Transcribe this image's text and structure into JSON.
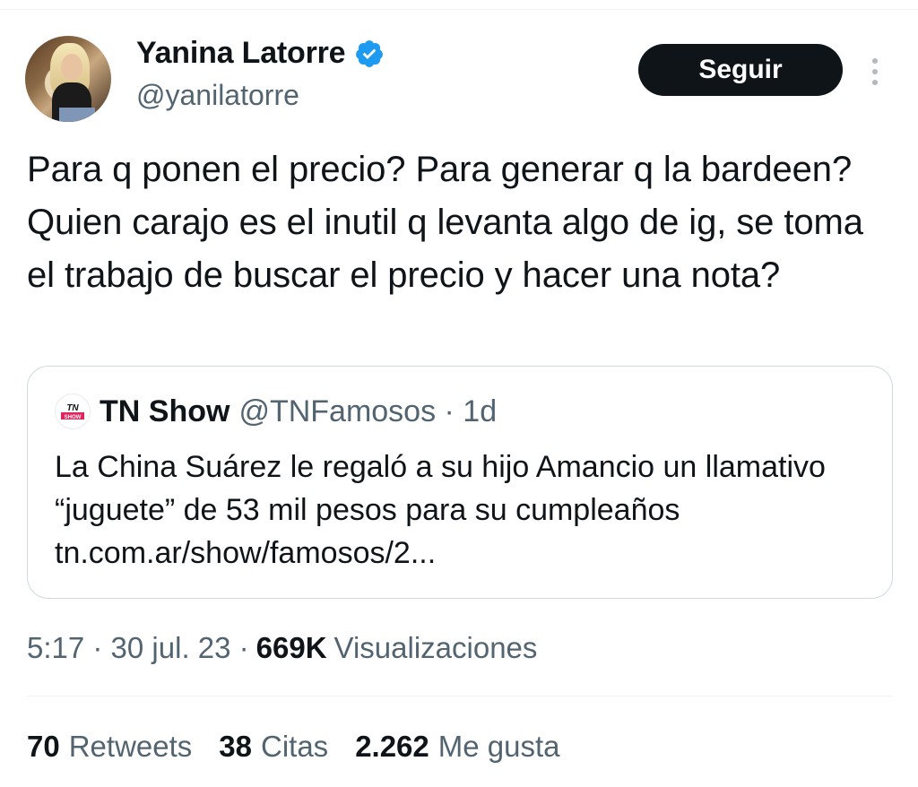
{
  "author": {
    "display_name": "Yanina Latorre",
    "handle": "@yanilatorre",
    "verified_color": "#1d9bf0"
  },
  "follow_button": {
    "label": "Seguir"
  },
  "tweet": {
    "text": "Para q ponen el precio? Para generar q la bardeen? Quien carajo es el inutil q levanta algo de ig, se toma el trabajo de buscar el precio y hacer una nota?"
  },
  "quote": {
    "avatar_text_top": "TN",
    "avatar_text_bottom": "SHOW",
    "name": "TN Show",
    "handle_time": "@TNFamosos · 1d",
    "text": "La China Suárez le regaló a su hijo Amancio un llamativo “juguete” de 53 mil pesos para su cumpleaños tn.com.ar/show/famosos/2..."
  },
  "meta": {
    "time_date": "5:17 · 30 jul. 23 ·",
    "views_count": "669K",
    "views_label": "Visualizaciones"
  },
  "stats": [
    {
      "count": "70",
      "label": "Retweets"
    },
    {
      "count": "38",
      "label": "Citas"
    },
    {
      "count": "2.262",
      "label": "Me gusta"
    }
  ],
  "colors": {
    "text_primary": "#0f1419",
    "text_secondary": "#536471",
    "border": "#cfd9de",
    "tn_red": "#e0245e"
  }
}
